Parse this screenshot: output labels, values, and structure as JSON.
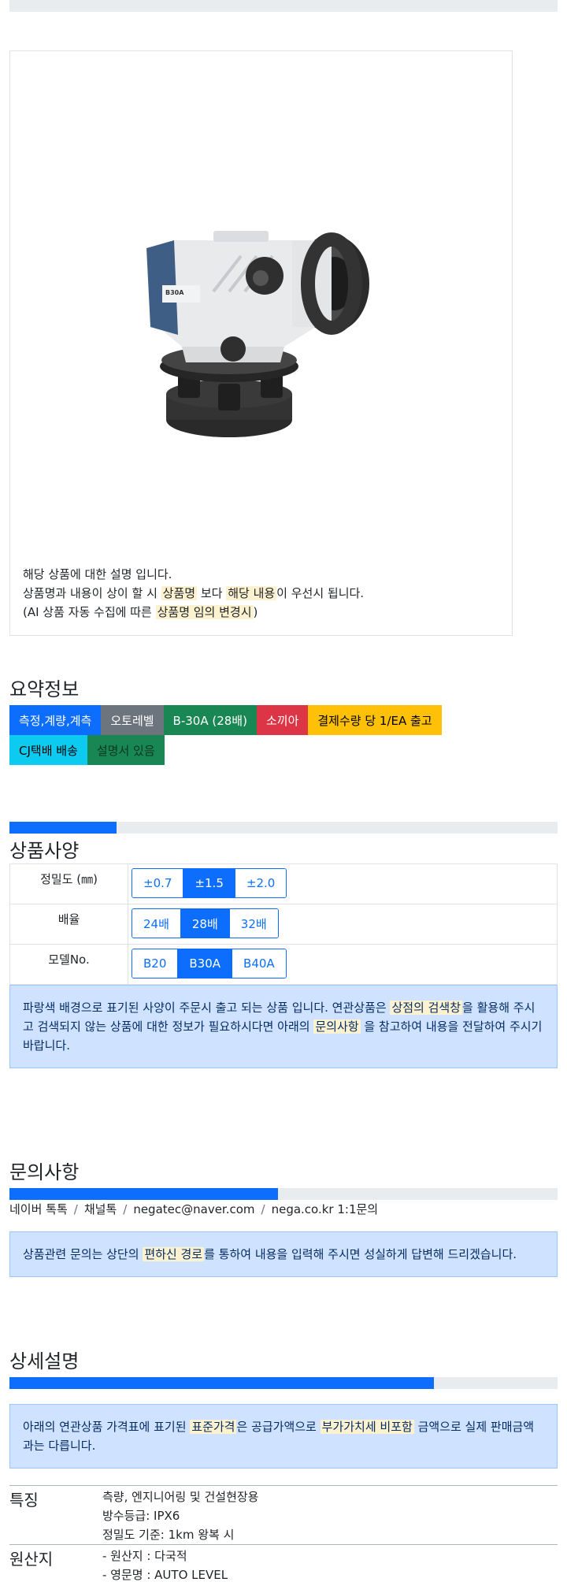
{
  "product": {
    "image_alt": "B30A auto level",
    "model_badge": "B30A",
    "desc_line1": "해당 상품에 대한 설명 입니다.",
    "desc_line2_a": "상품명과 내용이 상이 할 시 ",
    "desc_line2_mark1": "상품명",
    "desc_line2_b": " 보다 ",
    "desc_line2_mark2": "해당 내용",
    "desc_line2_c": "이 우선시 됩니다.",
    "desc_line3_a": "(AI 상품 자동 수집에 따른 ",
    "desc_line3_mark": "상품명 임의 변경시",
    "desc_line3_b": ")"
  },
  "summary": {
    "title": "요약정보",
    "badges_row1": [
      {
        "label": "측정,계량,계측",
        "color": "#0d6efd",
        "text_color": "#ffffff"
      },
      {
        "label": "오토레벨",
        "color": "#6c757d",
        "text_color": "#ffffff"
      },
      {
        "label": "B-30A (28배)",
        "color": "#198754",
        "text_color": "#ffffff"
      },
      {
        "label": "소끼아",
        "color": "#dc3545",
        "text_color": "#ffffff"
      },
      {
        "label": "결제수량 당 1/EA 출고",
        "color": "#ffc107",
        "text_color": "#000000"
      }
    ],
    "badges_row2": [
      {
        "label": "CJ택배 배송",
        "color": "#0dcaf0",
        "text_color": "#000000"
      },
      {
        "label": "설명서 있음",
        "color": "#198754",
        "text_color": "#0a3622"
      }
    ]
  },
  "specs": {
    "title": "상품사양",
    "progress_fraction": 0.195,
    "rows": [
      {
        "label": "정밀도 (㎜)",
        "options": [
          "±0.7",
          "±1.5",
          "±2.0"
        ],
        "selected": 1
      },
      {
        "label": "배율",
        "options": [
          "24배",
          "28배",
          "32배"
        ],
        "selected": 1
      },
      {
        "label": "모델No.",
        "options": [
          "B20",
          "B30A",
          "B40A"
        ],
        "selected": 1
      }
    ],
    "notice_a": "파랑색 배경으로 표기된 사양이 주문시 출고 되는 상품 입니다. 연관상품은 ",
    "notice_mark1": "상점의 검색창",
    "notice_b": "을 활용해 주시고 검색되지 않는 상품에 대한 정보가 필요하시다면 아래의 ",
    "notice_mark2": "문의사항",
    "notice_c": " 을 참고하여 내용을 전달하여 주시기 바랍니다."
  },
  "inquiry": {
    "title": "문의사항",
    "progress_fraction": 0.49,
    "channels": [
      "네이버 톡톡",
      "채널톡",
      "negatec@naver.com",
      "nega.co.kr 1:1문의"
    ],
    "channel_sep": "/",
    "notice_a": "상품관련 문의는 상단의 ",
    "notice_mark": "편하신 경로",
    "notice_b": "를 통하여 내용을 입력해 주시면 성실하게 답변해 드리겠습니다."
  },
  "detail": {
    "title": "상세설명",
    "progress_fraction": 0.775,
    "notice_a": "아래의 연관상품 가격표에 표기된 ",
    "notice_mark1": "표준가격",
    "notice_b": "은 공급가액으로 ",
    "notice_mark2": "부가가치세 비포함",
    "notice_c": " 금액으로 실제 판매금액과는 다릅니다.",
    "features": [
      {
        "key": "특징",
        "values": [
          "측량, 엔지니어링 및 건설현장용",
          "방수등급: IPX6",
          "정밀도 기준: 1km 왕복 시"
        ]
      },
      {
        "key": "원산지",
        "values": [
          "- 원산지 : 다국적",
          "- 영문명 : AUTO LEVEL"
        ]
      }
    ]
  }
}
